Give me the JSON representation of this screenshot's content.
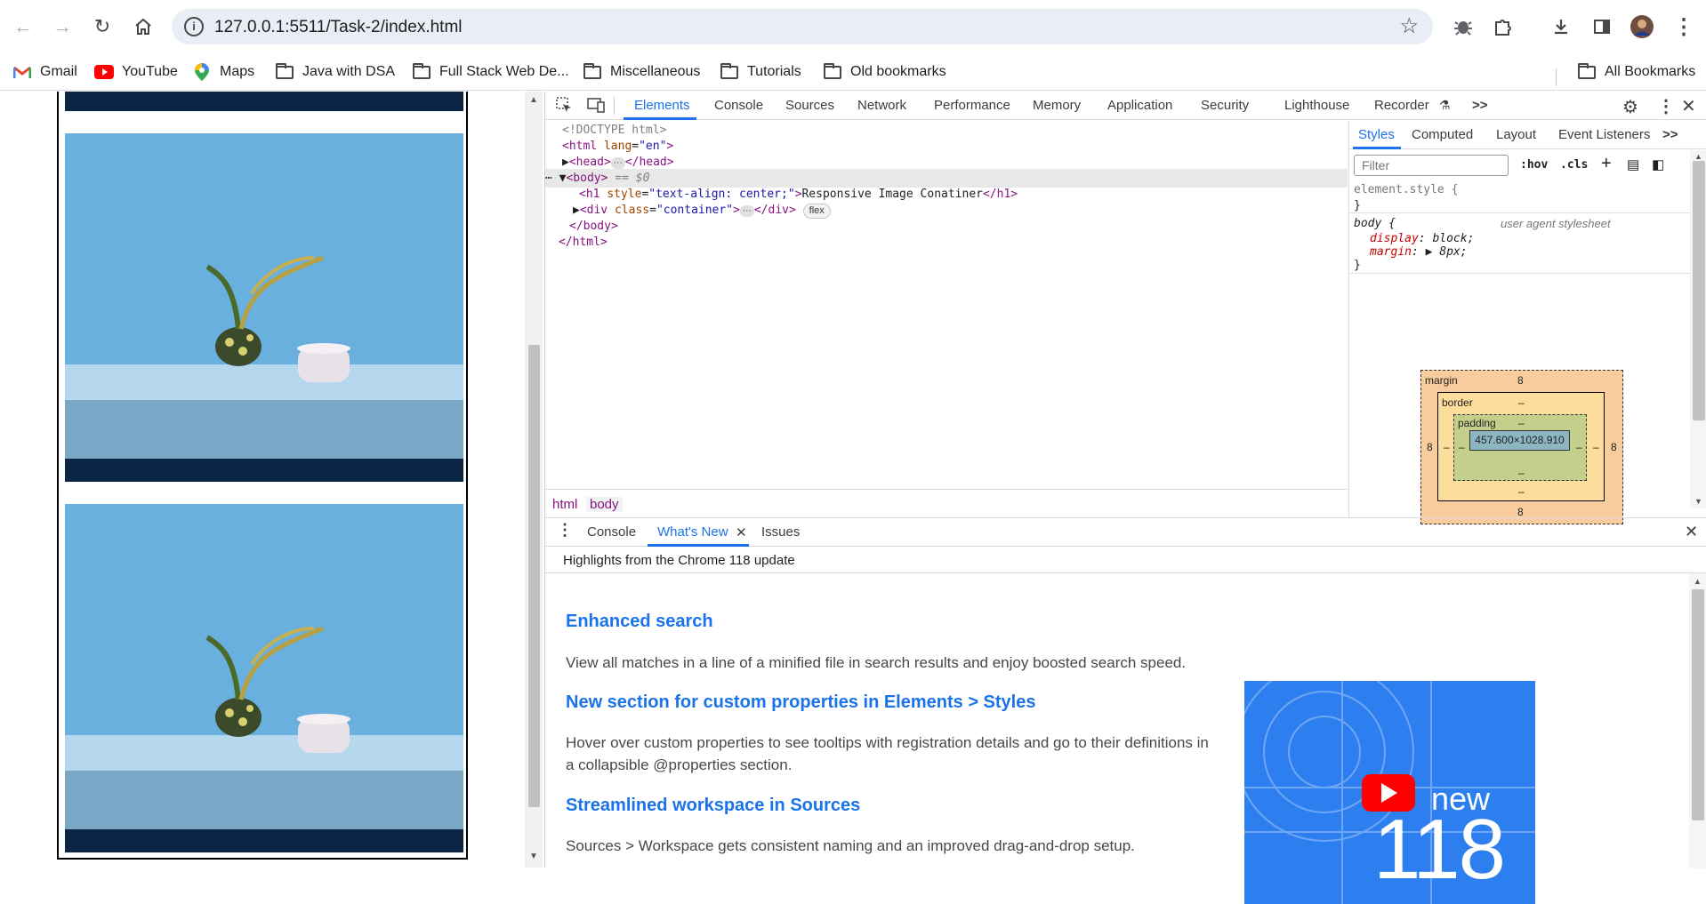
{
  "browser": {
    "url": "127.0.0.1:5511/Task-2/index.html",
    "nav_icons": [
      "back-icon",
      "forward-icon",
      "reload-icon",
      "home-icon"
    ],
    "bookmarks": [
      {
        "label": "Gmail",
        "icon": "gmail-icon"
      },
      {
        "label": "YouTube",
        "icon": "youtube-icon"
      },
      {
        "label": "Maps",
        "icon": "maps-icon"
      },
      {
        "label": "Java with DSA",
        "icon": "folder-icon"
      },
      {
        "label": "Full Stack Web De...",
        "icon": "folder-icon"
      },
      {
        "label": "Miscellaneous",
        "icon": "folder-icon"
      },
      {
        "label": "Tutorials",
        "icon": "folder-icon"
      },
      {
        "label": "Old bookmarks",
        "icon": "folder-icon"
      }
    ],
    "all_bookmarks": "All Bookmarks"
  },
  "devtools": {
    "tabs": [
      "Elements",
      "Console",
      "Sources",
      "Network",
      "Performance",
      "Memory",
      "Application",
      "Security",
      "Lighthouse",
      "Recorder"
    ],
    "more": ">>",
    "elements": {
      "doctype": "<!DOCTYPE html>",
      "html_open_tag": "<html",
      "html_lang_attr": "lang",
      "html_lang_val": "\"en\"",
      "html_close_bracket": ">",
      "head_open": "<head>",
      "head_close": "</head>",
      "body_open": "<body>",
      "body_selected": "== $0",
      "h1_open": "<h1",
      "h1_style_attr": "style",
      "h1_style_val": "\"text-align: center;\"",
      "h1_text": "Responsive Image Conatiner",
      "h1_close": "</h1>",
      "div_open": "<div",
      "div_class_attr": "class",
      "div_class_val": "\"container\"",
      "div_close": "</div>",
      "flex_badge": "flex",
      "ellipsis": "⋯",
      "body_close": "</body>",
      "html_close": "</html>"
    },
    "breadcrumbs": [
      "html",
      "body"
    ],
    "styles_tabs": [
      "Styles",
      "Computed",
      "Layout",
      "Event Listeners"
    ],
    "filter_placeholder": "Filter",
    "hov": ":hov",
    "cls": ".cls",
    "element_style": "element.style {",
    "close_brace": "}",
    "body_rule": "body {",
    "user_agent": "user agent stylesheet",
    "display_prop": "display",
    "display_val": "block;",
    "margin_prop": "margin",
    "margin_val": "8px;",
    "box_model": {
      "margin_label": "margin",
      "border_label": "border",
      "padding_label": "padding",
      "margin_top": "8",
      "margin_bottom": "8",
      "margin_left": "8",
      "margin_right": "8",
      "dash": "–",
      "content": "457.600×1028.910"
    },
    "drawer": {
      "tabs": [
        "Console",
        "What's New",
        "Issues"
      ],
      "active_tab": "What's New",
      "highlights": "Highlights from the Chrome 118 update",
      "features": [
        {
          "title": "Enhanced search",
          "desc": "View all matches in a line of a minified file in search results and enjoy boosted search speed."
        },
        {
          "title": "New section for custom properties in Elements > Styles",
          "desc": "Hover over custom properties to see tooltips with registration details and go to their definitions in a collapsible @properties section."
        },
        {
          "title": "Streamlined workspace in Sources",
          "desc": "Sources > Workspace gets consistent naming and an improved drag-and-drop setup."
        }
      ],
      "video": {
        "new_label": "new",
        "version": "118"
      }
    }
  }
}
